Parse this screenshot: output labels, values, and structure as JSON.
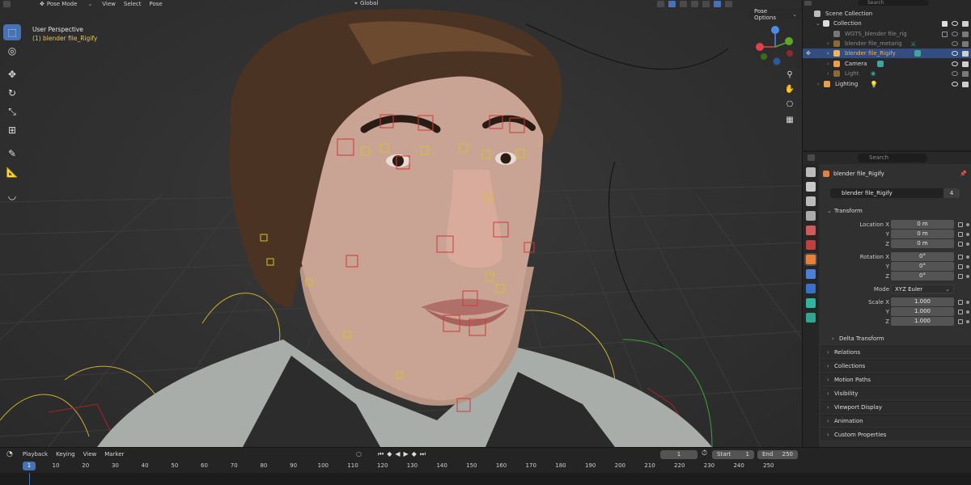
{
  "viewport_header": {
    "mode": "Pose Mode",
    "menus": [
      "View",
      "Select",
      "Pose"
    ],
    "transform_orientation": "Global"
  },
  "viewport": {
    "view_name": "User Perspective",
    "active_object": "(1) blender file_Rigify",
    "pose_options": "Pose Options",
    "gizmo_axes": {
      "x_color": "#e0414b",
      "y_color": "#5ea52a",
      "z_color": "#4a8de8"
    }
  },
  "outliner": {
    "search_placeholder": "Search",
    "rows": [
      {
        "name": "Scene Collection"
      },
      {
        "name": "Collection"
      },
      {
        "name": "WGTS_blender file_rig"
      },
      {
        "name": "blender file_metarig"
      },
      {
        "name": "blender file_Rigify"
      },
      {
        "name": "Camera"
      },
      {
        "name": "Light"
      },
      {
        "name": "Lighting"
      }
    ]
  },
  "properties": {
    "search_placeholder": "Search",
    "object_title": "blender file_Rigify",
    "object_field": "blender file_Rigify",
    "object_users": "4",
    "transform": {
      "header": "Transform",
      "location": {
        "label_x": "Location X",
        "label_y": "Y",
        "label_z": "Z",
        "x": "0 m",
        "y": "0 m",
        "z": "0 m"
      },
      "rotation": {
        "label_x": "Rotation X",
        "label_y": "Y",
        "label_z": "Z",
        "x": "0°",
        "y": "0°",
        "z": "0°"
      },
      "mode": {
        "label": "Mode",
        "value": "XYZ Euler"
      },
      "scale": {
        "label_x": "Scale X",
        "label_y": "Y",
        "label_z": "Z",
        "x": "1.000",
        "y": "1.000",
        "z": "1.000"
      },
      "delta": "Delta Transform"
    },
    "panels": [
      "Relations",
      "Collections",
      "Motion Paths",
      "Visibility",
      "Viewport Display",
      "Animation",
      "Custom Properties"
    ]
  },
  "timeline": {
    "menus": [
      "Playback",
      "Keying",
      "View",
      "Marker"
    ],
    "current_frame": "1",
    "start_label": "Start",
    "start": "1",
    "end_label": "End",
    "end": "250",
    "ruler": [
      "1",
      "10",
      "20",
      "30",
      "40",
      "50",
      "60",
      "70",
      "80",
      "90",
      "100",
      "110",
      "120",
      "130",
      "140",
      "150",
      "160",
      "170",
      "180",
      "190",
      "200",
      "210",
      "220",
      "230",
      "240",
      "250"
    ]
  },
  "colors": {
    "accent": "#4772b3",
    "selected_row": "#334d80",
    "armature": "#e6c55a",
    "bone_red": "#d03a3a"
  }
}
